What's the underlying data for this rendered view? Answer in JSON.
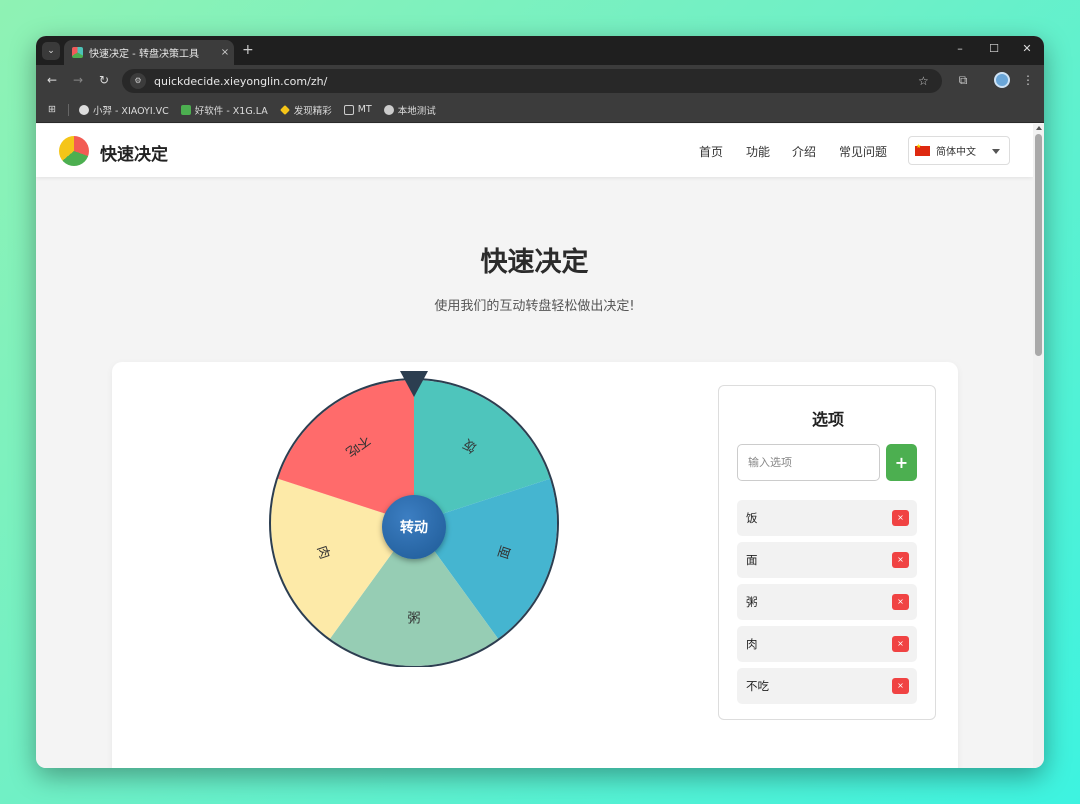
{
  "browser": {
    "tab_title": "快速决定 - 转盘决策工具",
    "tab_close": "×",
    "new_tab": "+",
    "url": "quickdecide.xieyonglin.com/zh/",
    "window_controls": [
      "–",
      "☐",
      "✕"
    ],
    "bookmarks": [
      {
        "label": "小羿 - XIAOYI.VC",
        "color": "#dddddd"
      },
      {
        "label": "好软件 - X1G.LA",
        "color": "#4caf50"
      },
      {
        "label": "发现精彩",
        "color": "#f5c518"
      },
      {
        "label": "MT",
        "color": "#cccccc"
      },
      {
        "label": "本地测试",
        "color": "#cccccc"
      }
    ]
  },
  "site": {
    "brand": "快速决定",
    "nav": [
      "首页",
      "功能",
      "介绍",
      "常见问题"
    ],
    "language": "简体中文"
  },
  "hero": {
    "title": "快速决定",
    "subtitle": "使用我们的互动转盘轻松做出决定!"
  },
  "wheel": {
    "spin_label": "转动",
    "segments": [
      {
        "label": "饭",
        "color": "#4ec5bc"
      },
      {
        "label": "面",
        "color": "#45b5d0"
      },
      {
        "label": "粥",
        "color": "#96cdb4"
      },
      {
        "label": "肉",
        "color": "#fdeaa8"
      },
      {
        "label": "不吃",
        "color": "#ff6b6b"
      }
    ],
    "pointer_color": "#2c3e50",
    "rim_color": "#2c3e50"
  },
  "options": {
    "title": "选项",
    "input_placeholder": "输入选项",
    "add_label": "+",
    "delete_label": "×",
    "items": [
      "饭",
      "面",
      "粥",
      "肉",
      "不吃"
    ]
  }
}
